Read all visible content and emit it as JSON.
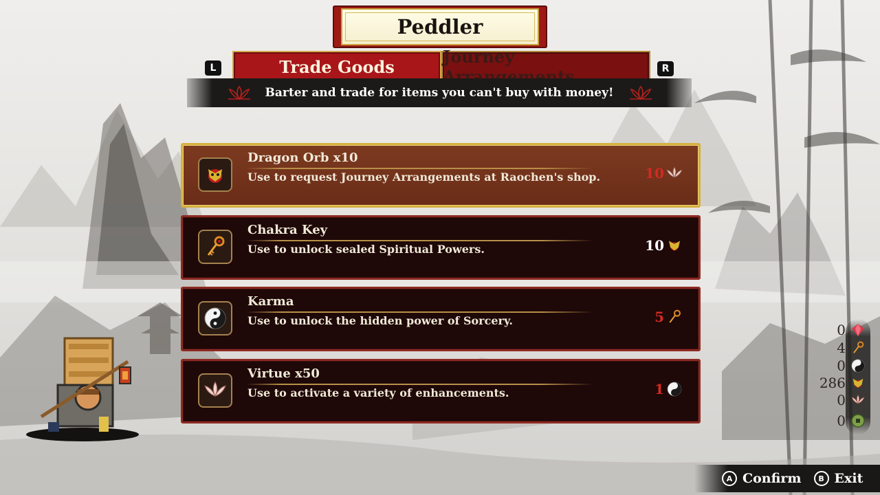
{
  "header": {
    "title": "Peddler"
  },
  "tabs": {
    "left_key": "L",
    "right_key": "R",
    "items": [
      {
        "label": "Trade Goods",
        "active": true
      },
      {
        "label": "Journey Arrangements",
        "active": false
      }
    ]
  },
  "subtitle": "Barter and trade for items you can't buy with money!",
  "items": [
    {
      "name": "Dragon Orb x10",
      "description": "Use to request Journey Arrangements at Raochen's shop.",
      "icon": "dragon-orb-icon",
      "cost": "10",
      "cost_icon": "virtue-lotus-icon",
      "cost_color": "#d42a22",
      "selected": true
    },
    {
      "name": "Chakra Key",
      "description": "Use to unlock sealed Spiritual Powers.",
      "icon": "chakra-key-icon",
      "cost": "10",
      "cost_icon": "dragon-orb-icon",
      "cost_color": "#ffffff",
      "selected": false
    },
    {
      "name": "Karma",
      "description": "Use to unlock the hidden power of Sorcery.",
      "icon": "karma-yin-yang-icon",
      "cost": "5",
      "cost_icon": "chakra-key-icon",
      "cost_color": "#d42a22",
      "selected": false
    },
    {
      "name": "Virtue x50",
      "description": "Use to activate a variety of enhancements.",
      "icon": "virtue-lotus-icon",
      "cost": "1",
      "cost_icon": "karma-yin-yang-icon",
      "cost_color": "#d42a22",
      "selected": false
    }
  ],
  "inventory": [
    {
      "count": "0",
      "icon": "red-gem-icon"
    },
    {
      "count": "4",
      "icon": "chakra-key-icon"
    },
    {
      "count": "0",
      "icon": "karma-yin-yang-icon"
    },
    {
      "count": "286",
      "icon": "dragon-orb-icon"
    },
    {
      "count": "0",
      "icon": "virtue-lotus-icon"
    },
    {
      "count": "0",
      "icon": "green-coin-icon"
    }
  ],
  "footer": {
    "confirm_key": "A",
    "confirm_label": "Confirm",
    "exit_key": "B",
    "exit_label": "Exit"
  },
  "colors": {
    "accent_red": "#a8161a",
    "gold": "#d6b03f",
    "cost_red": "#d42a22"
  }
}
